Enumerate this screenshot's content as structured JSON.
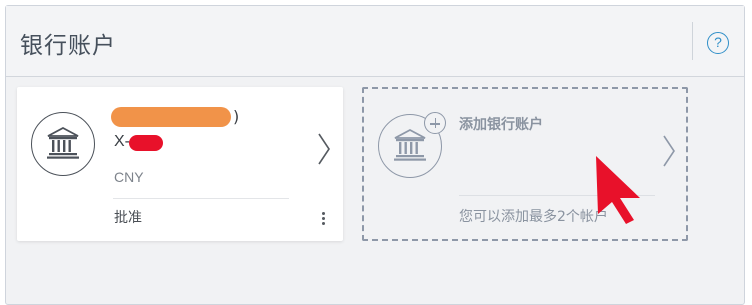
{
  "panel": {
    "title": "银行账户",
    "help_glyph": "?"
  },
  "account_card": {
    "bank_name_suffix": ")",
    "account_prefix": "X-",
    "currency": "CNY",
    "status": "批准",
    "icon": "bank-icon"
  },
  "add_card": {
    "title": "添加银行账户",
    "hint": "您可以添加最多2个帐户",
    "icon": "bank-add-icon"
  },
  "colors": {
    "accent": "#2f8fc8",
    "redaction_orange": "#f08a3a",
    "redaction_red": "#e8112a",
    "cursor": "#e8112a"
  }
}
